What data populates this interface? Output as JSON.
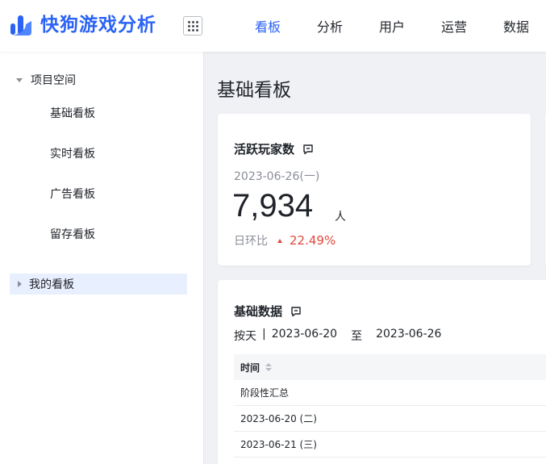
{
  "app": {
    "name": "快狗游戏分析"
  },
  "nav": [
    "看板",
    "分析",
    "用户",
    "运营",
    "数据"
  ],
  "sidebar": {
    "group": "项目空间",
    "items": [
      "基础看板",
      "实时看板",
      "广告看板",
      "留存看板"
    ],
    "my_group": "我的看板"
  },
  "page": {
    "title": "基础看板"
  },
  "kpi": {
    "title": "活跃玩家数",
    "date": "2023-06-26(一)",
    "value": "7,934",
    "unit": "人",
    "compare_label": "日环比",
    "compare_value": "22.49%"
  },
  "basic": {
    "title": "基础数据",
    "granularity": "按天",
    "separator": "|",
    "start": "2023-06-20",
    "to": "至",
    "end": "2023-06-26",
    "column": "时间",
    "rows": [
      "阶段性汇总",
      "2023-06-20 (二)",
      "2023-06-21 (三)"
    ]
  },
  "colors": {
    "brand": "#2b63f5",
    "up": "#e0493b"
  }
}
